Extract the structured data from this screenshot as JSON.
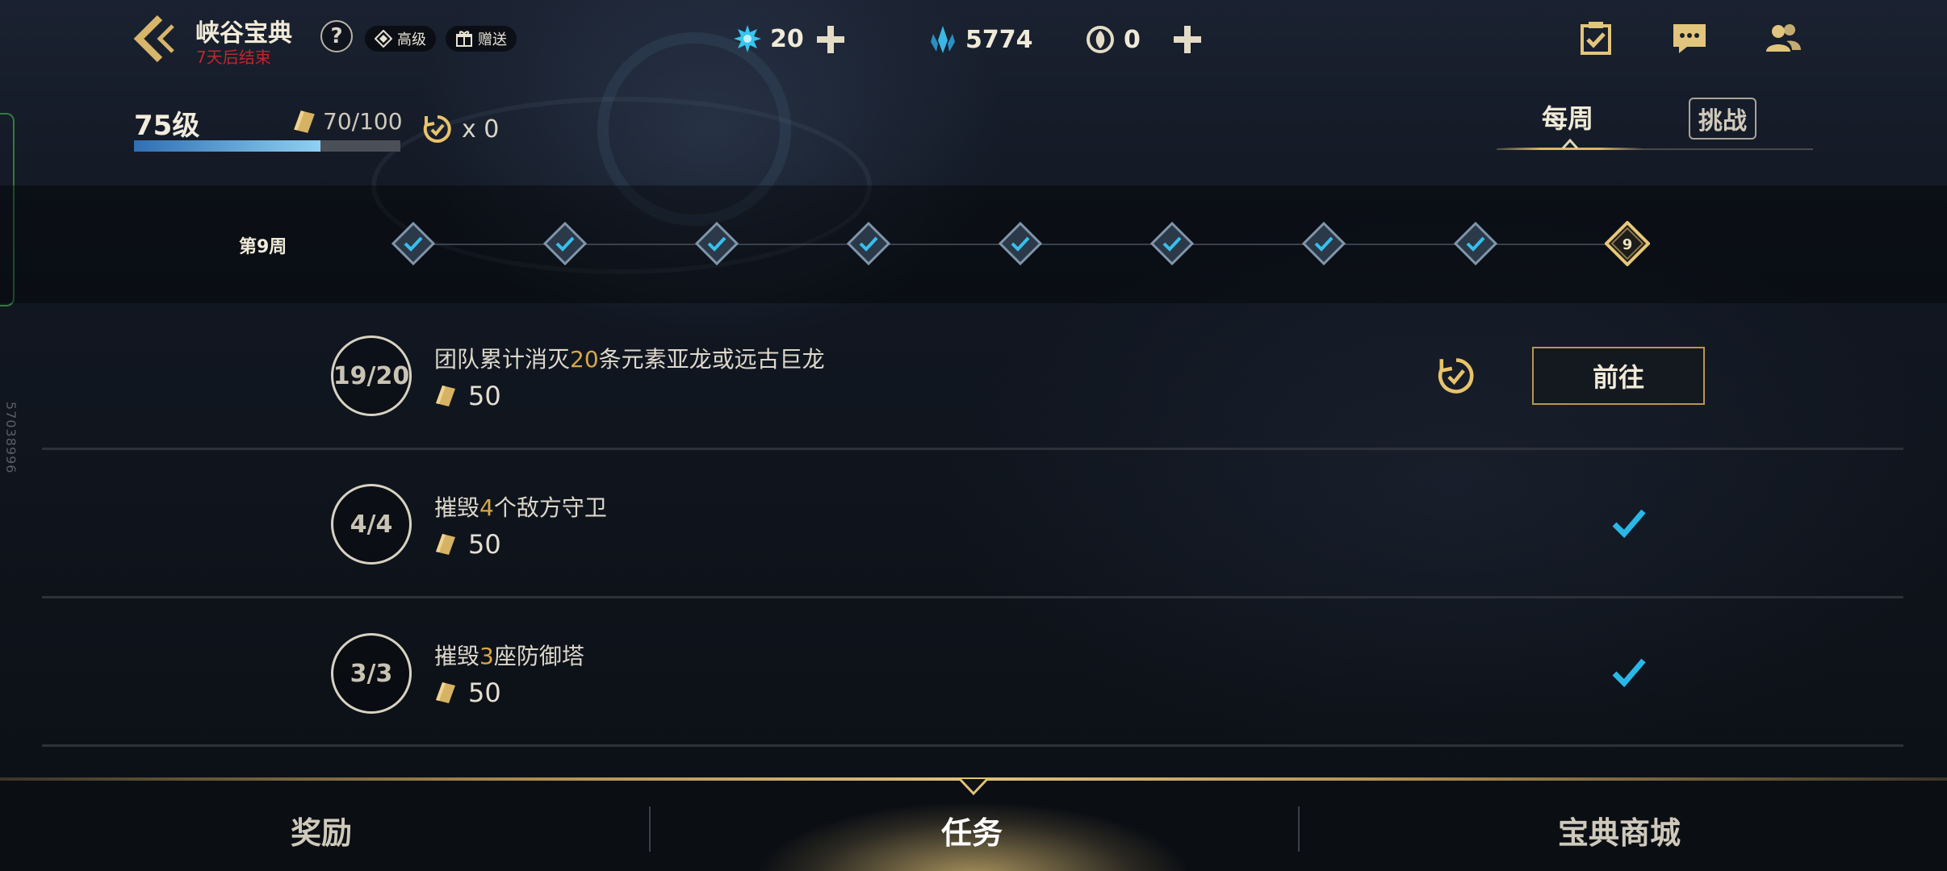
{
  "header": {
    "title": "峡谷宝典",
    "subtitle": "7天后结束",
    "help_label": "?",
    "premium_label": "高级",
    "gift_label": "赠送"
  },
  "currencies": {
    "blue_essence": "20",
    "crystals": "5774",
    "tokens": "0"
  },
  "header_icons": [
    "checklist-icon",
    "chat-icon",
    "friends-icon"
  ],
  "progress": {
    "level_label": "75级",
    "xp_text": "70/100",
    "xp_fraction": 0.7,
    "reroll_text": "x 0"
  },
  "tabs": {
    "weekly": "每周",
    "challenge": "挑战"
  },
  "weeks": {
    "label": "第9周",
    "completed_count": 8,
    "current_number": "9"
  },
  "tasks": [
    {
      "progress": "19/20",
      "title_prefix": "团队累计消灭",
      "title_highlight": "20",
      "title_suffix": "条元素亚龙或远古巨龙",
      "reward": "50",
      "status": "in-progress",
      "action_label": "前往"
    },
    {
      "progress": "4/4",
      "title_prefix": "摧毁",
      "title_highlight": "4",
      "title_suffix": "个敌方守卫",
      "reward": "50",
      "status": "completed"
    },
    {
      "progress": "3/3",
      "title_prefix": "摧毁",
      "title_highlight": "3",
      "title_suffix": "座防御塔",
      "reward": "50",
      "status": "completed"
    }
  ],
  "bottom_nav": {
    "rewards": "奖励",
    "missions": "任务",
    "store": "宝典商城",
    "active": "missions"
  },
  "side_id": "57038996",
  "colors": {
    "accent_gold": "#d7b56a",
    "highlight_gold": "#d8a64a",
    "check_blue": "#28b8e8",
    "xp_blue": "#8fd0f2",
    "end_red": "#c0272d"
  }
}
